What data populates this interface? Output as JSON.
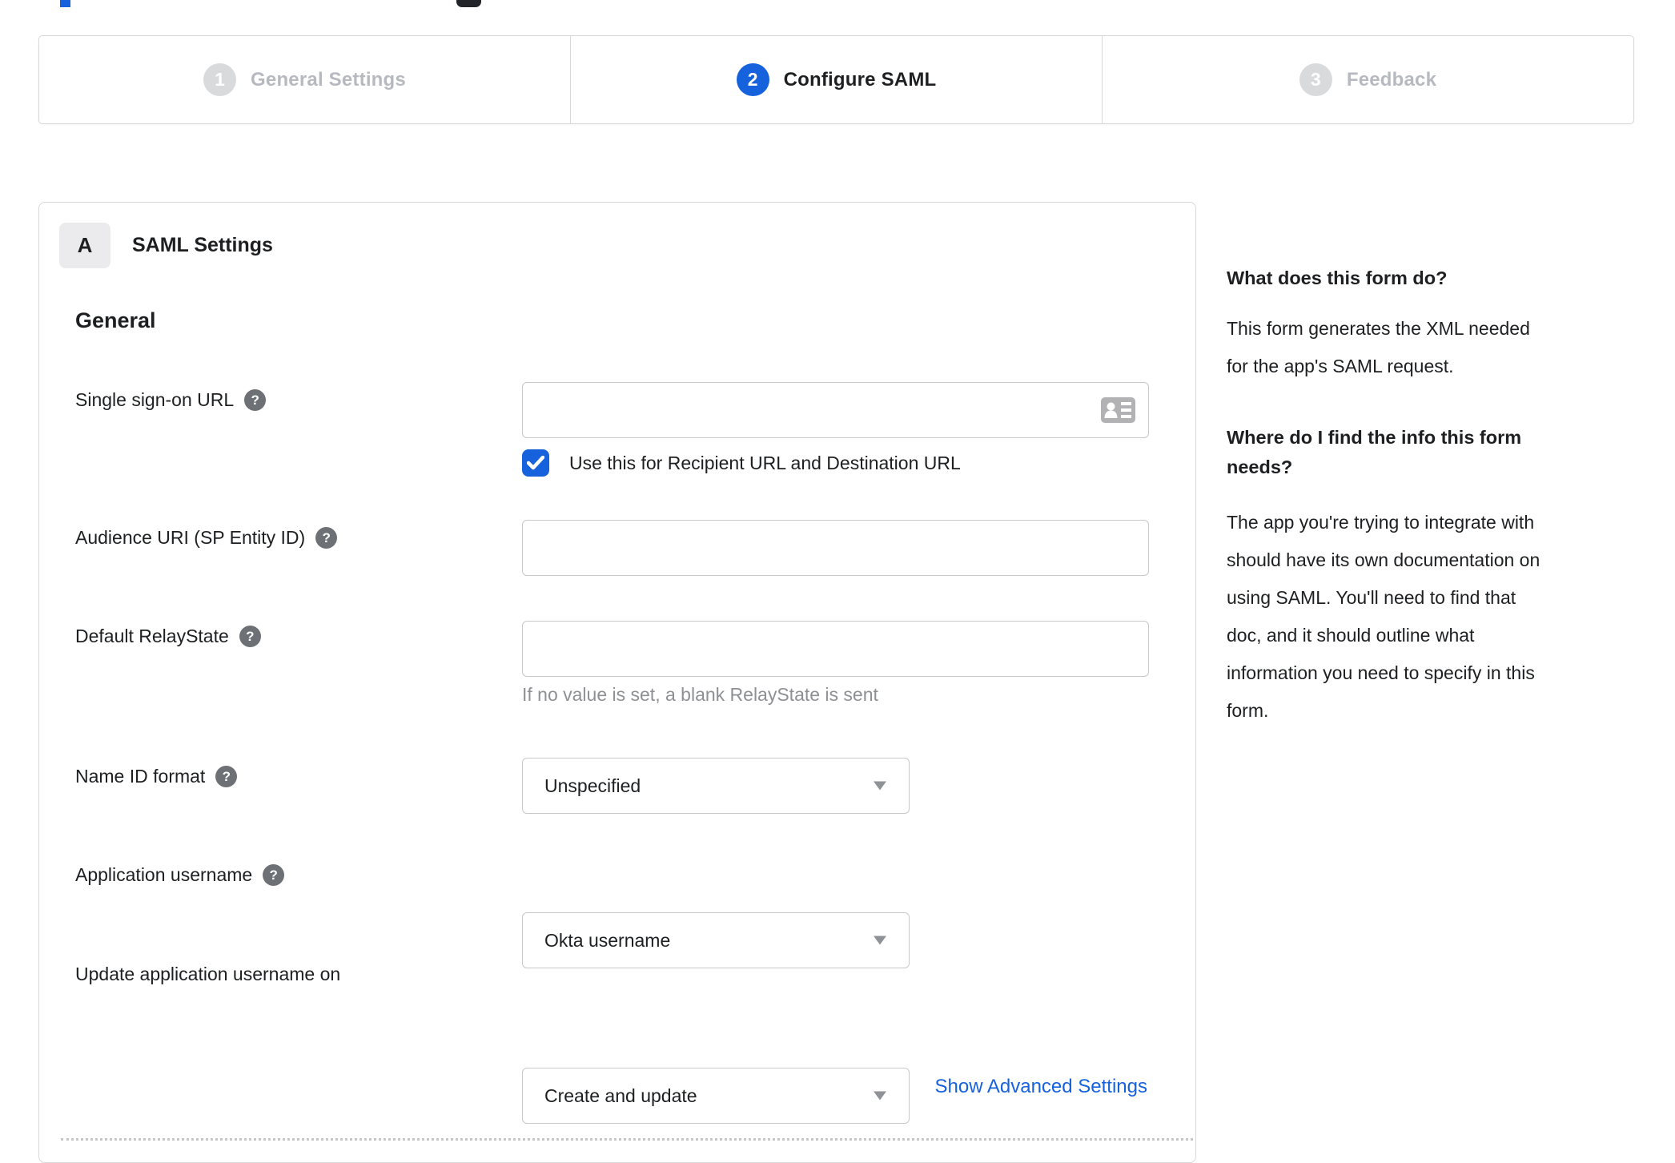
{
  "colors": {
    "accent_blue": "#1662dd",
    "inactive_gray": "#d9dadc",
    "text_dark": "#1d1f21",
    "muted_text": "#8e9094",
    "border": "#d8d8d8"
  },
  "stepper": {
    "steps": [
      {
        "number": "1",
        "label": "General Settings",
        "state": "inactive"
      },
      {
        "number": "2",
        "label": "Configure SAML",
        "state": "active"
      },
      {
        "number": "3",
        "label": "Feedback",
        "state": "inactive"
      }
    ]
  },
  "panel": {
    "badge": "A",
    "title": "SAML Settings",
    "section_heading": "General",
    "fields": {
      "sso": {
        "label": "Single sign-on URL",
        "value": "",
        "checkbox_label": "Use this for Recipient URL and Destination URL",
        "checkbox_checked": true
      },
      "audience": {
        "label": "Audience URI (SP Entity ID)",
        "value": ""
      },
      "relay": {
        "label": "Default RelayState",
        "value": "",
        "hint": "If no value is set, a blank RelayState is sent"
      },
      "nameid": {
        "label": "Name ID format",
        "value": "Unspecified"
      },
      "appuser": {
        "label": "Application username",
        "value": "Okta username"
      },
      "updateuser": {
        "label": "Update application username on",
        "value": "Create and update"
      }
    },
    "advanced_link": "Show Advanced Settings"
  },
  "sidebar": {
    "q1": "What does this form do?",
    "a1_lines": [
      "This form generates the XML needed",
      "for the app's SAML request."
    ],
    "a1": "This form generates the XML needed for the app's SAML request.",
    "q2_lines": [
      "Where do I find the info this form",
      "needs?"
    ],
    "q2": "Where do I find the info this form needs?",
    "a2_lines": [
      "The app you're trying to integrate with",
      "should have its own documentation on",
      "using SAML. You'll need to find that",
      "doc, and it should outline what",
      "information you need to specify in this",
      "form."
    ],
    "a2": "The app you're trying to integrate with should have its own documentation on using SAML. You'll need to find that doc, and it should outline what information you need to specify in this form."
  }
}
